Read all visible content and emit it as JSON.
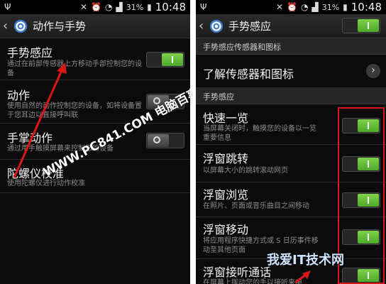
{
  "status_bar": {
    "battery": "31%",
    "time": "10:48"
  },
  "left": {
    "title": "动作与手势",
    "items": [
      {
        "title": "手势感应",
        "subtitle": "通过在前部传感器上方移动手部控制您的设备",
        "toggle": "on"
      },
      {
        "title": "动作",
        "subtitle": "使用自然的动作控制您的设备，如将设备置于您耳边以直接呼叫联",
        "toggle": "off"
      },
      {
        "title": "手掌动作",
        "subtitle": "通过用手触摸屏幕来控制您的设备",
        "toggle": "off"
      },
      {
        "title": "陀螺仪校准",
        "subtitle": "使用陀螺仪进行动作校准"
      }
    ],
    "watermark": "WWW.PC841.COM 电脑百事网"
  },
  "right": {
    "title": "手势感应",
    "master_toggle": "on",
    "section1": "手势感应传感器和图标",
    "learn_item": "了解传感器和图标",
    "section2": "手势感应",
    "items": [
      {
        "title": "快速一览",
        "subtitle": "当屏幕关闭时，触摸您的设备以一览重要信息",
        "toggle": "on"
      },
      {
        "title": "浮窗跳转",
        "subtitle": "以屏幕大小的跳转滚动网页",
        "toggle": "on"
      },
      {
        "title": "浮窗浏览",
        "subtitle": "在照片、页面或音乐曲目之间移动",
        "toggle": "on"
      },
      {
        "title": "浮窗移动",
        "subtitle": "将应用程序快捷方式或 S 日历事件移动至其他页面",
        "toggle": "on"
      },
      {
        "title": "浮窗接听通话",
        "subtitle": "在屏幕上挥动您的手以接听来电",
        "toggle": "on"
      }
    ],
    "watermark": "我爱IT技术网"
  },
  "colors": {
    "accent_green": "#5bbf33",
    "highlight_red": "#d81818",
    "background": "#0b0b0b"
  }
}
